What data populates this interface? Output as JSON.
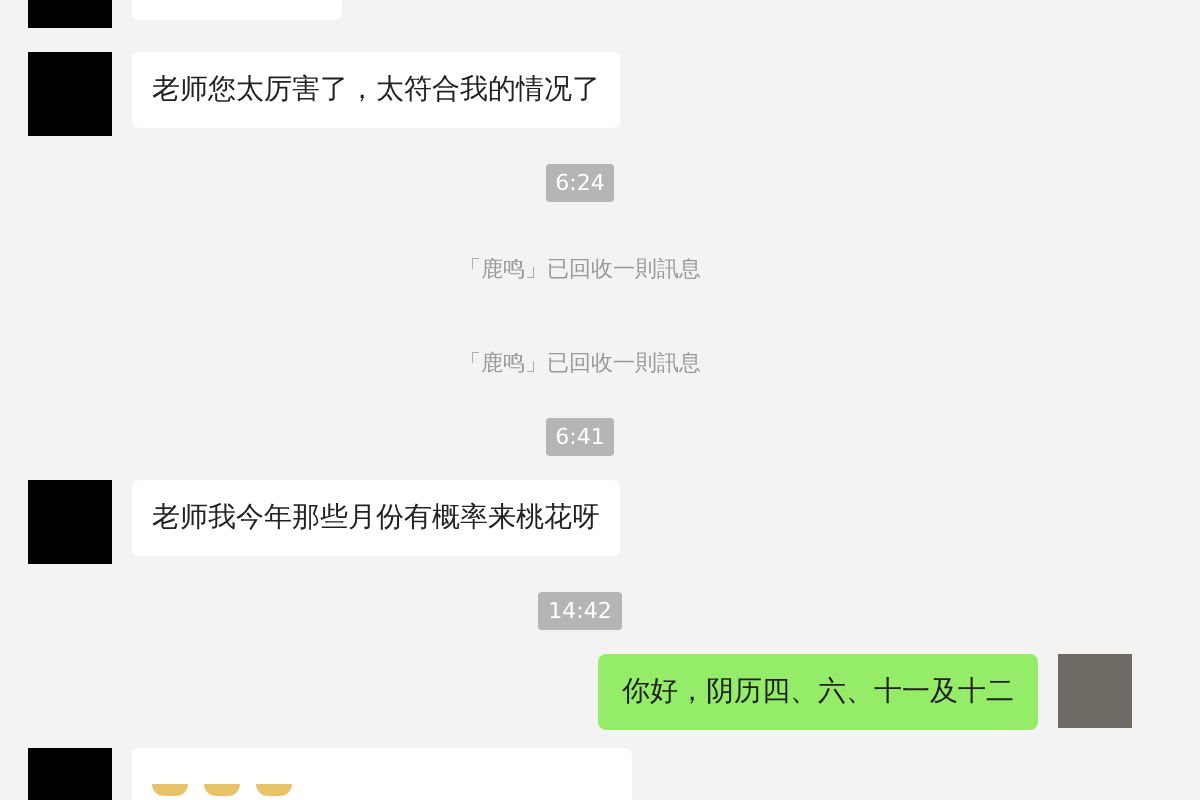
{
  "messages": [
    {
      "kind": "incoming_cut_top"
    },
    {
      "kind": "incoming",
      "text": "老师您太厉害了，太符合我的情况了"
    },
    {
      "kind": "time",
      "text": "6:24"
    },
    {
      "kind": "notice",
      "text": "「鹿鸣」已回收一則訊息"
    },
    {
      "kind": "notice",
      "text": "「鹿鸣」已回收一則訊息"
    },
    {
      "kind": "time",
      "text": "6:41"
    },
    {
      "kind": "incoming",
      "text": "老师我今年那些月份有概率来桃花呀"
    },
    {
      "kind": "time",
      "text": "14:42"
    },
    {
      "kind": "outgoing",
      "text": "你好，阴历四、六、十一及十二"
    },
    {
      "kind": "incoming_cut_bottom"
    }
  ]
}
